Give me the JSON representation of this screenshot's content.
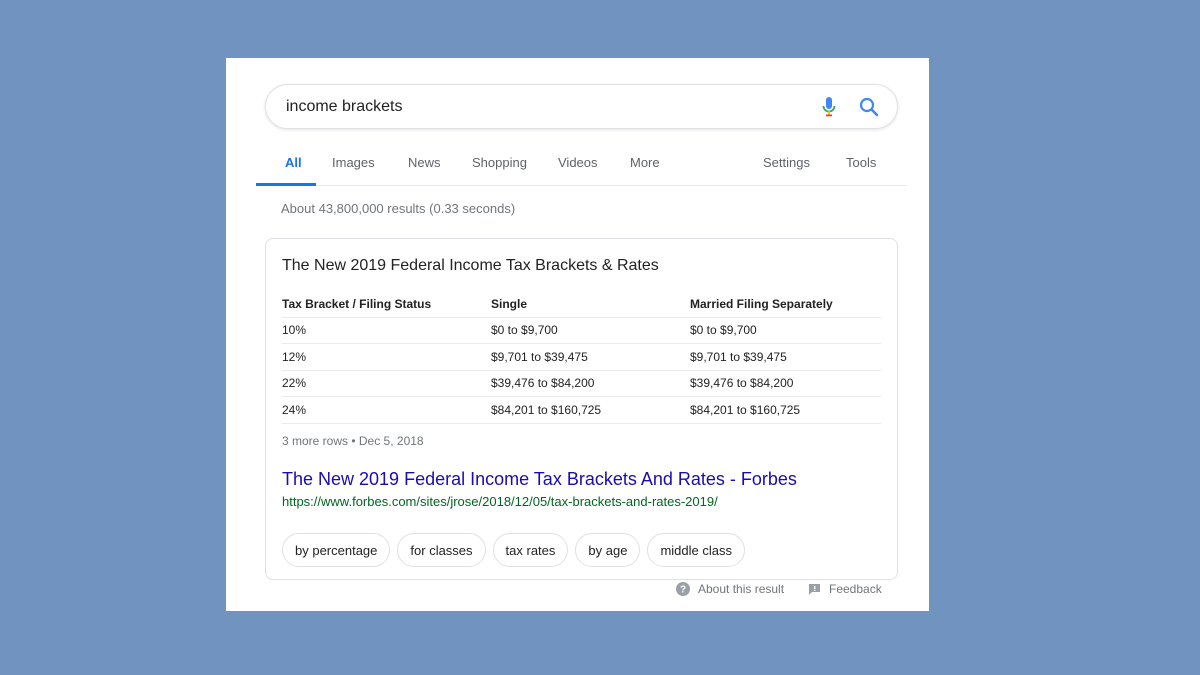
{
  "search": {
    "query": "income brackets"
  },
  "tabs": {
    "items": [
      "All",
      "Images",
      "News",
      "Shopping",
      "Videos",
      "More"
    ],
    "right": [
      "Settings",
      "Tools"
    ],
    "active": "All"
  },
  "stats": "About 43,800,000 results (0.33 seconds)",
  "snippet": {
    "title": "The New 2019 Federal Income Tax Brackets & Rates",
    "headers": [
      "Tax Bracket / Filing Status",
      "Single",
      "Married Filing Separately"
    ],
    "rows": [
      [
        "10%",
        "$0 to $9,700",
        "$0 to $9,700"
      ],
      [
        "12%",
        "$9,701 to $39,475",
        "$9,701 to $39,475"
      ],
      [
        "22%",
        "$39,476 to $84,200",
        "$39,476 to $84,200"
      ],
      [
        "24%",
        "$84,201 to $160,725",
        "$84,201 to $160,725"
      ]
    ],
    "more_rows": "3 more rows • Dec 5, 2018",
    "link_text": "The New 2019 Federal Income Tax Brackets And Rates - Forbes",
    "url": "https://www.forbes.com/sites/jrose/2018/12/05/tax-brackets-and-rates-2019/",
    "chips": [
      "by percentage",
      "for classes",
      "tax rates",
      "by age",
      "middle class"
    ]
  },
  "footer": {
    "about": "About this result",
    "feedback": "Feedback"
  },
  "colors": {
    "background": "#7193bf",
    "accent": "#1a73e8",
    "link": "#1a0dab",
    "url": "#006621"
  },
  "icons": {
    "mic": "mic-icon",
    "search": "search-icon",
    "help": "help-icon",
    "feedback": "feedback-icon"
  }
}
